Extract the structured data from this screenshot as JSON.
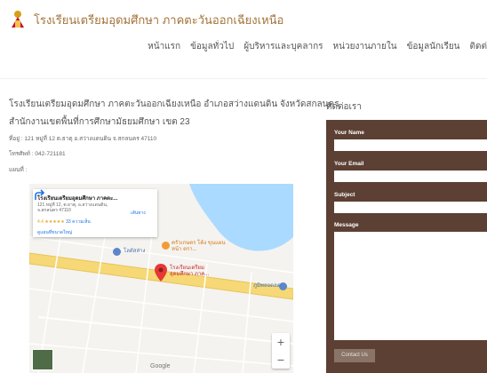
{
  "header": {
    "site_title": "โรงเรียนเตรียมอุดมศึกษา ภาคตะวันออกเฉียงเหนือ",
    "nav": [
      "หน้าแรก",
      "ข้อมูลทั่วไป",
      "ผู้บริหารและบุคลากร",
      "หน่วยงานภายใน",
      "ข้อมูลนักเรียน",
      "ติดต่"
    ]
  },
  "school": {
    "name": "โรงเรียนเตรียมอุดมศึกษา ภาคตะวันออกเฉียงเหนือ อำเภอสว่างแดนดิน  จังหวัดสกลนคร",
    "office": "สำนักงานเขตพื้นที่การศึกษามัธยมศึกษา เขต 23",
    "address": "ที่อยู่ : 121 หมู่ที่ 12  ต.ธาตุ  อ.สว่างแดนดิน  จ.สกลนคร  47110",
    "phone": "โทรศัพท์ : 042-721181",
    "map_label": "แผนที่ :"
  },
  "map": {
    "card_title": "โรงเรียนเตรียมอุดมศึกษา ภาคตะ...",
    "card_address": "121 หมู่ที่ 12, ต.ธาตุ, อ.สว่างแดนดิน, จ.สกลนคร 47110",
    "rating": "4.4 ★★★★★",
    "reviews": "33 ความเห็น",
    "directions": "เส้นทาง",
    "bigger_map": "ดูแผนที่ขนาดใหญ่",
    "place_1": "โลตัสส่าง",
    "place_2": "ครัวเกษตร โค้ง ขุนแผนหน้า ตรา...",
    "place_3": "โรงเรียนเตรียม อุดมศึกษา ภาค...",
    "place_4": "ภูมิพลอดลต",
    "zoom_in": "+",
    "zoom_out": "−",
    "google": "Google"
  },
  "contact": {
    "heading": "ติดต่อเรา",
    "name_label": "Your Name",
    "email_label": "Your Email",
    "subject_label": "Subject",
    "message_label": "Message",
    "submit_label": "Contact Us"
  },
  "colors": {
    "brand": "#a5733a",
    "form_bg": "#5c4033",
    "submit_bg": "#8a7467",
    "pin": "#e53935"
  }
}
